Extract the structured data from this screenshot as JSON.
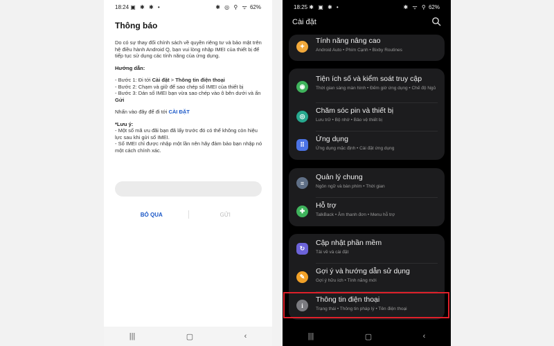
{
  "left": {
    "status": {
      "time": "18:24",
      "left_icons": "▣ ✱ ✱ •",
      "right_icons": "✱ ◎ ⚲ ᯤ",
      "battery": "62%"
    },
    "title": "Thông báo",
    "intro": "Do có sự thay đổi chính sách về quyền riêng tư và bảo mật trên hệ điều hành Android Q, bạn vui lòng nhập IMEI của thiết bị để tiếp tục sử dụng các tính năng của ứng dụng.",
    "guide_label": "Hướng dẫn:",
    "step1_prefix": "- Bước 1: Đi tới ",
    "step1_b1": "Cài đặt",
    "step1_mid": " > ",
    "step1_b2": "Thông tin điện thoại",
    "step2": "- Bước 2: Chạm và giữ để sao chép số IMEI của thiết bị",
    "step3_prefix": "- Bước 3: Dán số IMEI bạn vừa sao chép vào ô bên dưới và ấn ",
    "step3_b": "Gửi",
    "tap_text": "Nhấn vào đây để đi tới ",
    "tap_link": "CÀI ĐẶT",
    "note_label": "*Lưu ý:",
    "note1": "- Một số mã ưu đãi bạn đã lấy trước đó có thể không còn hiệu lực sau khi gửi số IMEI.",
    "note2": "- Số IMEI chỉ được nhập một lần nên hãy đảm bảo bạn nhập nó một cách chính xác.",
    "skip_label": "BỎ QUA",
    "send_label": "GỬI",
    "nav": {
      "recent": "|||",
      "home": "▢",
      "back": "‹"
    }
  },
  "right": {
    "status": {
      "time": "18:25",
      "left_icons": "✱ ▣ ✱ •",
      "right_icons": "✱ ᯤ ⚲",
      "battery": "62%"
    },
    "header": "Cài đặt",
    "search_icon": "search-icon",
    "items": [
      {
        "title": "Tính năng nâng cao",
        "sub": "Android Auto  •  Phím Cạnh  •  Bixby Routines",
        "color": "#f2a93b",
        "icon": "advanced-features-icon",
        "glyph": "✦"
      },
      {
        "title": "Tiện ích số và kiểm soát truy cập",
        "sub": "Thời gian sàng màn hình  •  Đếm giờ ứng dụng  •  Chế độ Ngủ",
        "color": "#3fb35c",
        "icon": "digital-wellbeing-icon",
        "glyph": "◉"
      },
      {
        "title": "Chăm sóc pin và thiết bị",
        "sub": "Lưu trữ  •  Bộ nhớ  •  Bảo vệ thiết bị",
        "color": "#27a88e",
        "icon": "device-care-icon",
        "glyph": "◎"
      },
      {
        "title": "Ứng dụng",
        "sub": "Ứng dụng mặc định  •  Cài đặt ứng dụng",
        "color": "#4b73e6",
        "icon": "apps-icon",
        "glyph": "⠿"
      },
      {
        "title": "Quản lý chung",
        "sub": "Ngôn ngữ và bàn phím  •  Thời gian",
        "color": "#5f6f86",
        "icon": "general-management-icon",
        "glyph": "≡"
      },
      {
        "title": "Hỗ trợ",
        "sub": "TalkBack  •  Âm thanh đơn  •  Menu hỗ trợ",
        "color": "#3fb35c",
        "icon": "accessibility-icon",
        "glyph": "✚"
      },
      {
        "title": "Cập nhật phần mềm",
        "sub": "Tải về và cài đặt",
        "color": "#6c63d9",
        "icon": "software-update-icon",
        "glyph": "↻"
      },
      {
        "title": "Gợi ý và hướng dẫn sử dụng",
        "sub": "Gợi ý hữu ích  •  Tính năng mới",
        "color": "#f0a028",
        "icon": "tips-icon",
        "glyph": "✎"
      },
      {
        "title": "Thông tin điện thoại",
        "sub": "Trạng thái  •  Thông tin pháp lý  •  Tên điện thoại",
        "color": "#7b7b80",
        "icon": "about-phone-icon",
        "glyph": "i"
      }
    ],
    "nav": {
      "recent": "|||",
      "home": "▢",
      "back": "‹"
    }
  }
}
